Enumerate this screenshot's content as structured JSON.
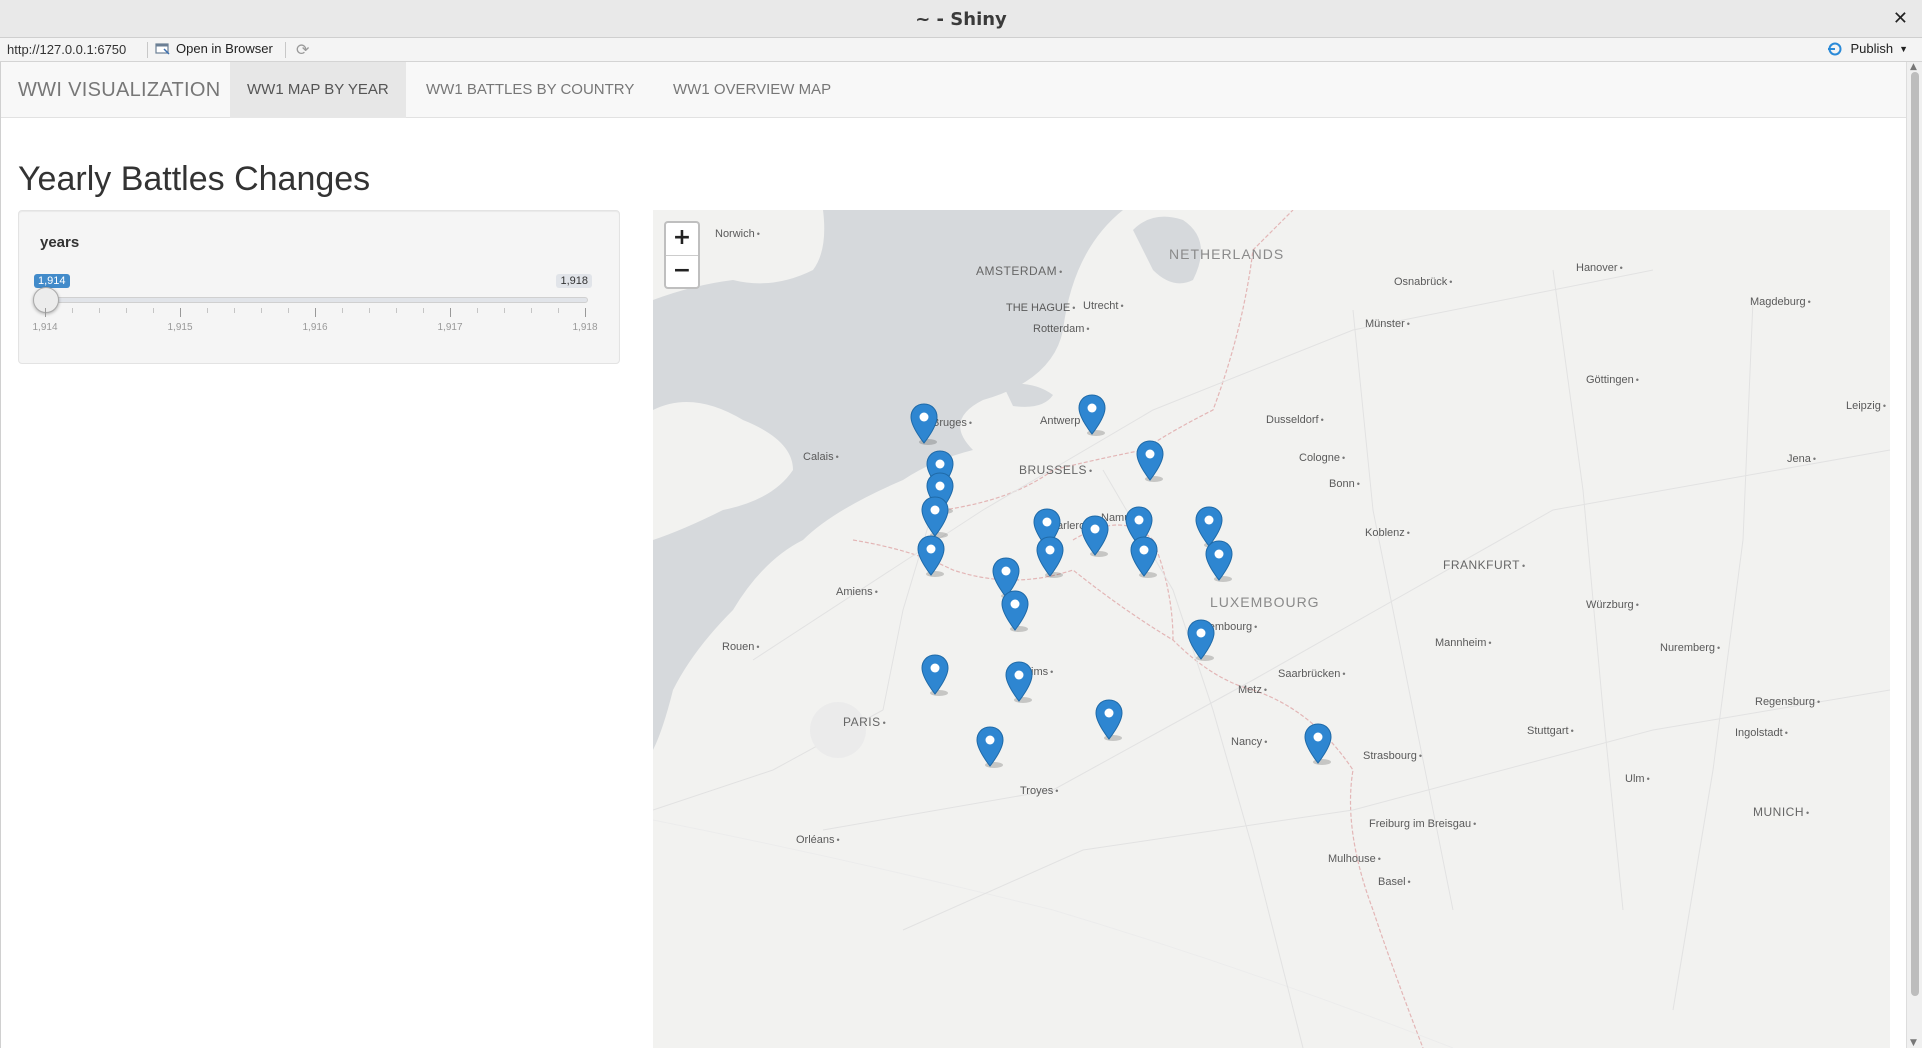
{
  "window": {
    "title": "~ - Shiny",
    "close_label": "✕"
  },
  "toolbar": {
    "url": "http://127.0.0.1:6750",
    "open_label": "Open in Browser",
    "publish_label": "Publish"
  },
  "navbar": {
    "brand": "WWI VISUALIZATION",
    "tabs": [
      {
        "label": "WW1 MAP BY YEAR",
        "active": true
      },
      {
        "label": "WW1 BATTLES BY COUNTRY",
        "active": false
      },
      {
        "label": "WW1 OVERVIEW MAP",
        "active": false
      }
    ]
  },
  "page": {
    "title": "Yearly Battles Changes"
  },
  "slider": {
    "label": "years",
    "min": 1914,
    "max": 1918,
    "from_label": "1,914",
    "to_label": "1,918",
    "value": 1914,
    "tick_labels": [
      "1,914",
      "1,915",
      "1,916",
      "1,917",
      "1,918"
    ]
  },
  "map": {
    "zoom_in": "+",
    "zoom_out": "−",
    "places": [
      "Norwich",
      "AMSTERDAM",
      "NETHERLANDS",
      "THE HAGUE",
      "Utrecht",
      "Rotterdam",
      "Osnabrück",
      "Hanover",
      "Magdeburg",
      "Münster",
      "Göttingen",
      "Leipzig",
      "Bruges",
      "Antwerp",
      "Dusseldorf",
      "Calais",
      "BRUSSELS",
      "Cologne",
      "Jena",
      "Bonn",
      "Charleroi",
      "Namur",
      "Koblenz",
      "FRANKFURT",
      "Amiens",
      "LUXEMBOURG",
      "Luxembourg",
      "Würzburg",
      "Rouen",
      "Mannheim",
      "Nuremberg",
      "Reims",
      "Saarbrücken",
      "Metz",
      "Regensburg",
      "PARIS",
      "Stuttgart",
      "Ingolstadt",
      "Nancy",
      "Strasbourg",
      "Ulm",
      "Troyes",
      "MUNICH",
      "Freiburg im Breisgau",
      "Orléans",
      "Mulhouse",
      "Basel"
    ],
    "marker_count": 22
  },
  "colors": {
    "accent": "#428bca",
    "marker": "#2e86d1",
    "sea": "#d6d9dc",
    "land": "#f2f2f0"
  }
}
